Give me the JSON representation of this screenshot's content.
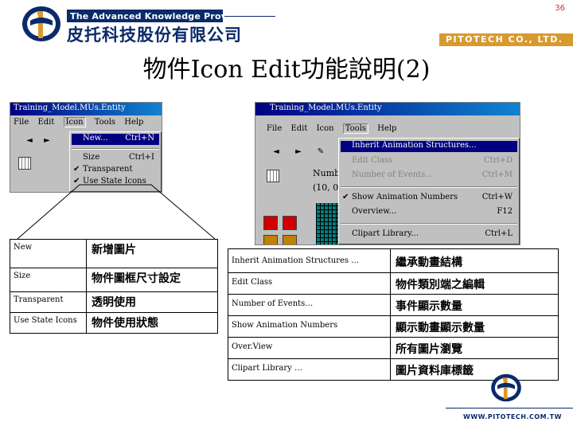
{
  "header": {
    "page_number": "36",
    "tagline": "The Advanced Knowledge Provider",
    "company_cn": "皮托科技股份有限公司",
    "company_en": "PITOTECH CO., LTD."
  },
  "slide": {
    "title": "物件Icon Edit功能說明(2)"
  },
  "window_left": {
    "title": "Training_Model.MUs.Entity",
    "menus": [
      "File",
      "Edit",
      "Icon",
      "Tools",
      "Help"
    ],
    "icon_menu": [
      {
        "label": "New...",
        "shortcut": "Ctrl+N"
      },
      {
        "label": "Size",
        "shortcut": "Ctrl+I"
      },
      {
        "label": "Transparent",
        "shortcut": ""
      },
      {
        "label": "Use State Icons",
        "shortcut": ""
      }
    ]
  },
  "window_right": {
    "title": "Training_Model.MUs.Entity",
    "menus": [
      "File",
      "Edit",
      "Icon",
      "Tools",
      "Help"
    ],
    "bg_text1": "Numb",
    "bg_text2": "(10, 0",
    "tools_menu": [
      {
        "label": "Inherit Animation Structures...",
        "shortcut": ""
      },
      {
        "label": "Edit Class",
        "shortcut": "Ctrl+D"
      },
      {
        "label": "Number of Events...",
        "shortcut": "Ctrl+M"
      },
      {
        "label": "Show Animation Numbers",
        "shortcut": "Ctrl+W"
      },
      {
        "label": "Overview...",
        "shortcut": "F12"
      },
      {
        "label": "Clipart Library...",
        "shortcut": "Ctrl+L"
      }
    ]
  },
  "table_left": [
    {
      "en": "New",
      "cn": "新增圖片"
    },
    {
      "en": "Size",
      "cn": "物件圖框尺寸設定"
    },
    {
      "en": "Transparent",
      "cn": "透明使用"
    },
    {
      "en": "Use State Icons",
      "cn": "物件使用狀態"
    }
  ],
  "table_right": [
    {
      "en": "Inherit Animation Structures …",
      "cn": "繼承動畫結構"
    },
    {
      "en": "Edit Class",
      "cn": "物件類別端之編輯"
    },
    {
      "en": "Number of Events…",
      "cn": "事件顯示數量"
    },
    {
      "en": "Show Animation Numbers",
      "cn": "顯示動畫顯示數量"
    },
    {
      "en": "Over.View",
      "cn": "所有圖片瀏覽"
    },
    {
      "en": "Clipart Library …",
      "cn": "圖片資料庫標籤"
    }
  ],
  "footer": {
    "url": "WWW.PITOTECH.COM.TW"
  },
  "colors": {
    "navy": "#0a2a6a",
    "gold": "#d89a2e",
    "title_blue": "#000080",
    "menu_gray": "#c0c0c0"
  }
}
